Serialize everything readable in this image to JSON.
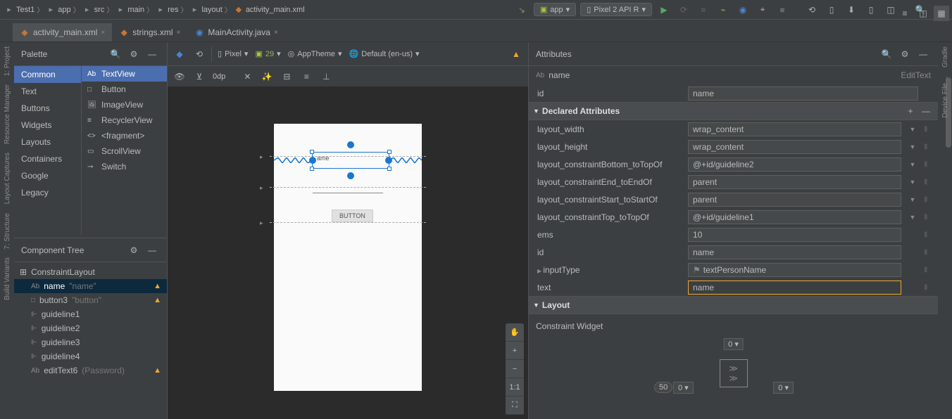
{
  "breadcrumbs": [
    {
      "icon": "project",
      "label": "Test1"
    },
    {
      "icon": "folder",
      "label": "app"
    },
    {
      "icon": "folder",
      "label": "src"
    },
    {
      "icon": "folder",
      "label": "main"
    },
    {
      "icon": "folder",
      "label": "res"
    },
    {
      "icon": "folder",
      "label": "layout"
    },
    {
      "icon": "xml",
      "label": "activity_main.xml"
    }
  ],
  "run_config": "app",
  "device_target": "Pixel 2 API R",
  "tabs": [
    {
      "icon": "xml",
      "label": "activity_main.xml",
      "active": true,
      "closable": true
    },
    {
      "icon": "xml",
      "label": "strings.xml",
      "active": false,
      "closable": true
    },
    {
      "icon": "java",
      "label": "MainActivity.java",
      "active": false,
      "closable": true
    }
  ],
  "left_tools": [
    "1: Project",
    "Resource Manager",
    "Layout Captures",
    "7: Structure",
    "Build Variants"
  ],
  "right_tools": [
    "Gradle",
    "Device File…"
  ],
  "palette": {
    "title": "Palette",
    "categories": [
      "Common",
      "Text",
      "Buttons",
      "Widgets",
      "Layouts",
      "Containers",
      "Google",
      "Legacy"
    ],
    "items": [
      {
        "icon": "Ab",
        "label": "TextView",
        "active": true
      },
      {
        "icon": "□",
        "label": "Button"
      },
      {
        "icon": "🖼",
        "label": "ImageView"
      },
      {
        "icon": "≡",
        "label": "RecyclerView"
      },
      {
        "icon": "<>",
        "label": "<fragment>"
      },
      {
        "icon": "▭",
        "label": "ScrollView"
      },
      {
        "icon": "⊸",
        "label": "Switch"
      }
    ]
  },
  "component_tree": {
    "title": "Component Tree",
    "root": "ConstraintLayout",
    "children": [
      {
        "icon": "Ab",
        "name": "name",
        "suffix": "\"name\"",
        "warn": true,
        "sel": true
      },
      {
        "icon": "□",
        "name": "button3",
        "suffix": "\"button\"",
        "warn": true
      },
      {
        "icon": "⊩",
        "name": "guideline1"
      },
      {
        "icon": "⊩",
        "name": "guideline2"
      },
      {
        "icon": "⊩",
        "name": "guideline3"
      },
      {
        "icon": "⊩",
        "name": "guideline4"
      },
      {
        "icon": "Ab",
        "name": "editText6",
        "suffix": "(Password)",
        "warn": true
      }
    ]
  },
  "design_toolbar": {
    "device": "Pixel",
    "api": "29",
    "theme": "AppTheme",
    "locale": "Default (en-us)",
    "dp": "0dp"
  },
  "canvas": {
    "edittext_text": "ame",
    "button_label": "BUTTON"
  },
  "attributes": {
    "title": "Attributes",
    "component_name": "name",
    "component_type": "EditText",
    "id": "name",
    "sections": {
      "declared": "Declared Attributes",
      "layout": "Layout",
      "constraint_widget": "Constraint Widget"
    },
    "rows": [
      {
        "label": "layout_width",
        "value": "wrap_content",
        "dd": true
      },
      {
        "label": "layout_height",
        "value": "wrap_content",
        "dd": true
      },
      {
        "label": "layout_constraintBottom_toTopOf",
        "value": "@+id/guideline2",
        "dd": true
      },
      {
        "label": "layout_constraintEnd_toEndOf",
        "value": "parent",
        "dd": true
      },
      {
        "label": "layout_constraintStart_toStartOf",
        "value": "parent",
        "dd": true
      },
      {
        "label": "layout_constraintTop_toTopOf",
        "value": "@+id/guideline1",
        "dd": true
      },
      {
        "label": "ems",
        "value": "10"
      },
      {
        "label": "id",
        "value": "name"
      },
      {
        "label": "inputType",
        "value": "textPersonName",
        "flag": true,
        "expand": true
      },
      {
        "label": "text",
        "value": "name",
        "highlight": true
      }
    ],
    "cw": {
      "top": "0",
      "left": "0",
      "right": "0",
      "bias": "50"
    }
  }
}
